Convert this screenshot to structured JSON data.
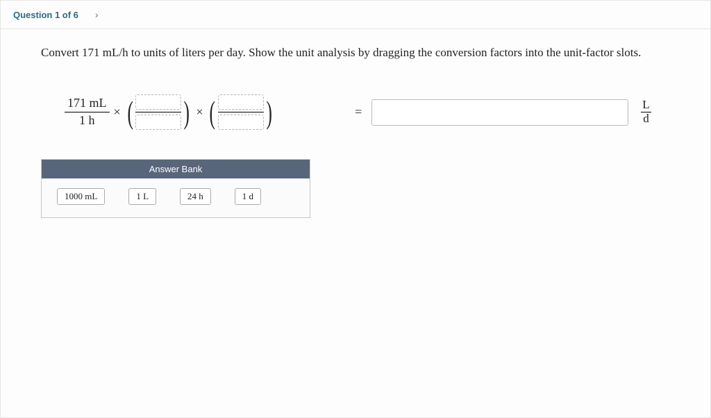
{
  "header": {
    "question_label": "Question 1 of 6",
    "next_glyph": "›"
  },
  "prompt": "Convert 171 mL/h to units of liters per day. Show the unit analysis by dragging the conversion factors into the unit-factor slots.",
  "given": {
    "numerator": "171 mL",
    "denominator": "1 h"
  },
  "operators": {
    "times": "×",
    "equals": "="
  },
  "result_unit": {
    "numerator": "L",
    "denominator": "d"
  },
  "answer_input": {
    "value": ""
  },
  "answer_bank": {
    "title": "Answer Bank",
    "items": [
      "1000 mL",
      "1 L",
      "24 h",
      "1 d"
    ]
  }
}
